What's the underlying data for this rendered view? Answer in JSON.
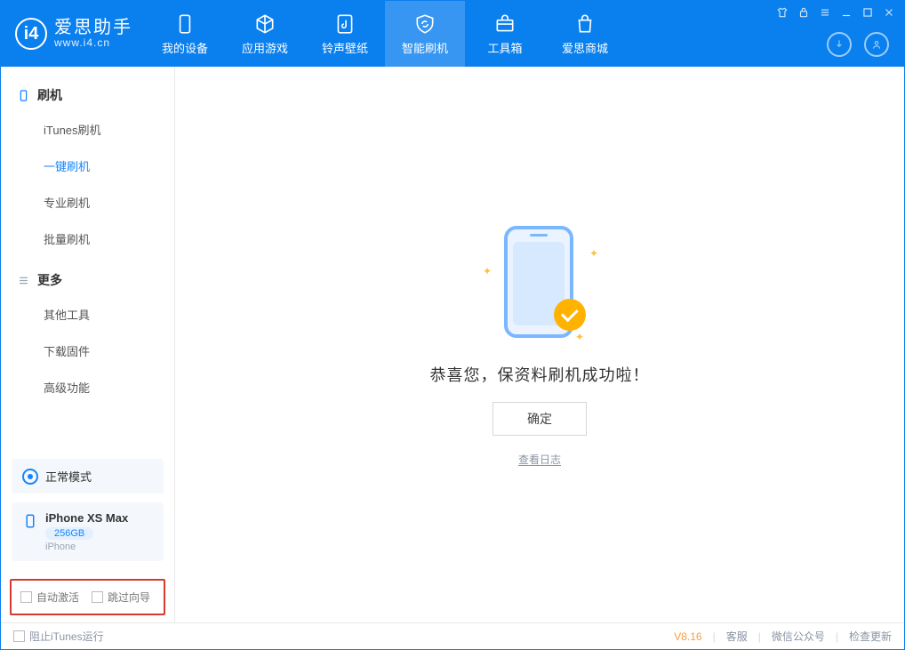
{
  "brand": {
    "name": "爱思助手",
    "url": "www.i4.cn"
  },
  "topTabs": [
    {
      "id": "device",
      "label": "我的设备"
    },
    {
      "id": "apps",
      "label": "应用游戏"
    },
    {
      "id": "ring",
      "label": "铃声壁纸"
    },
    {
      "id": "flash",
      "label": "智能刷机",
      "active": true
    },
    {
      "id": "tools",
      "label": "工具箱"
    },
    {
      "id": "store",
      "label": "爱思商城"
    }
  ],
  "sidebar": {
    "groups": [
      {
        "title": "刷机",
        "icon": "phone-icon",
        "items": [
          {
            "id": "itunes",
            "label": "iTunes刷机"
          },
          {
            "id": "oneclick",
            "label": "一键刷机",
            "active": true
          },
          {
            "id": "pro",
            "label": "专业刷机"
          },
          {
            "id": "batch",
            "label": "批量刷机"
          }
        ]
      },
      {
        "title": "更多",
        "icon": "menu-icon",
        "items": [
          {
            "id": "other",
            "label": "其他工具"
          },
          {
            "id": "fw",
            "label": "下载固件"
          },
          {
            "id": "adv",
            "label": "高级功能"
          }
        ]
      }
    ],
    "mode": {
      "label": "正常模式"
    },
    "device": {
      "name": "iPhone XS Max",
      "storage": "256GB",
      "type": "iPhone"
    },
    "checks": {
      "autoActivate": "自动激活",
      "skipGuide": "跳过向导"
    }
  },
  "main": {
    "message": "恭喜您，保资料刷机成功啦！",
    "okButton": "确定",
    "logLink": "查看日志"
  },
  "footer": {
    "blockItunes": "阻止iTunes运行",
    "version": "V8.16",
    "links": {
      "service": "客服",
      "wechat": "微信公众号",
      "update": "检查更新"
    }
  }
}
